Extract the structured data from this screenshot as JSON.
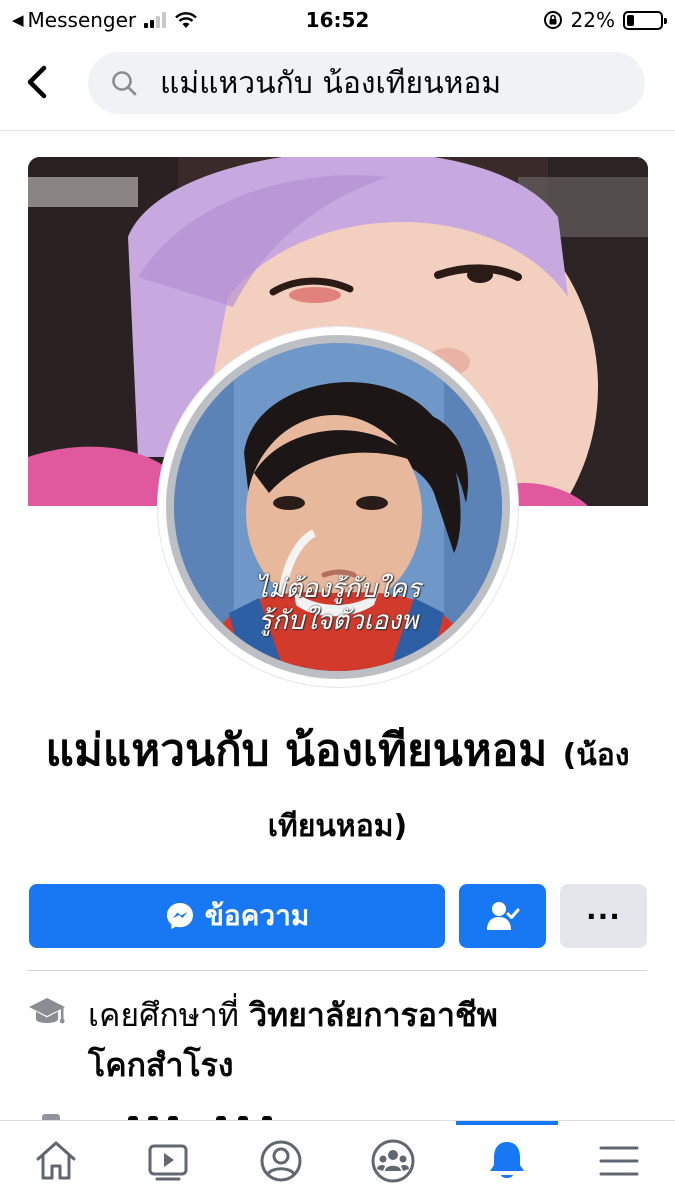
{
  "status_bar": {
    "back_app": "Messenger",
    "time": "16:52",
    "battery": "22%",
    "battery_level": 0.22
  },
  "search": {
    "query": "แม่แหวนกับ น้องเทียนหอม"
  },
  "cover": {
    "image": "cover-photo-child-lilac-hood"
  },
  "profile": {
    "avatar_caption_line1": "ไม่ต้องรู้กับใคร",
    "avatar_caption_line2": "รู้กับใจตัวเองพ",
    "name": "แม่แหวนกับ น้องเทียนหอม",
    "alternate_name": "(น้องเทียนหอม)"
  },
  "actions": {
    "message_label": "ข้อความ",
    "friend_icon": "friend-check-icon",
    "more_label": "···"
  },
  "intro": {
    "education_prefix": "เคยศึกษาที่",
    "education_school": "วิทยาลัยการอาชีพโคกสำโรง"
  },
  "tabbar": {
    "tabs": [
      "home-icon",
      "watch-icon",
      "profile-icon",
      "groups-icon",
      "notifications-icon",
      "menu-icon"
    ],
    "active": "notifications-icon"
  },
  "colors": {
    "accent": "#1877f2",
    "secondary_button": "#e4e6eb",
    "search_bg": "#f0f2f5"
  }
}
